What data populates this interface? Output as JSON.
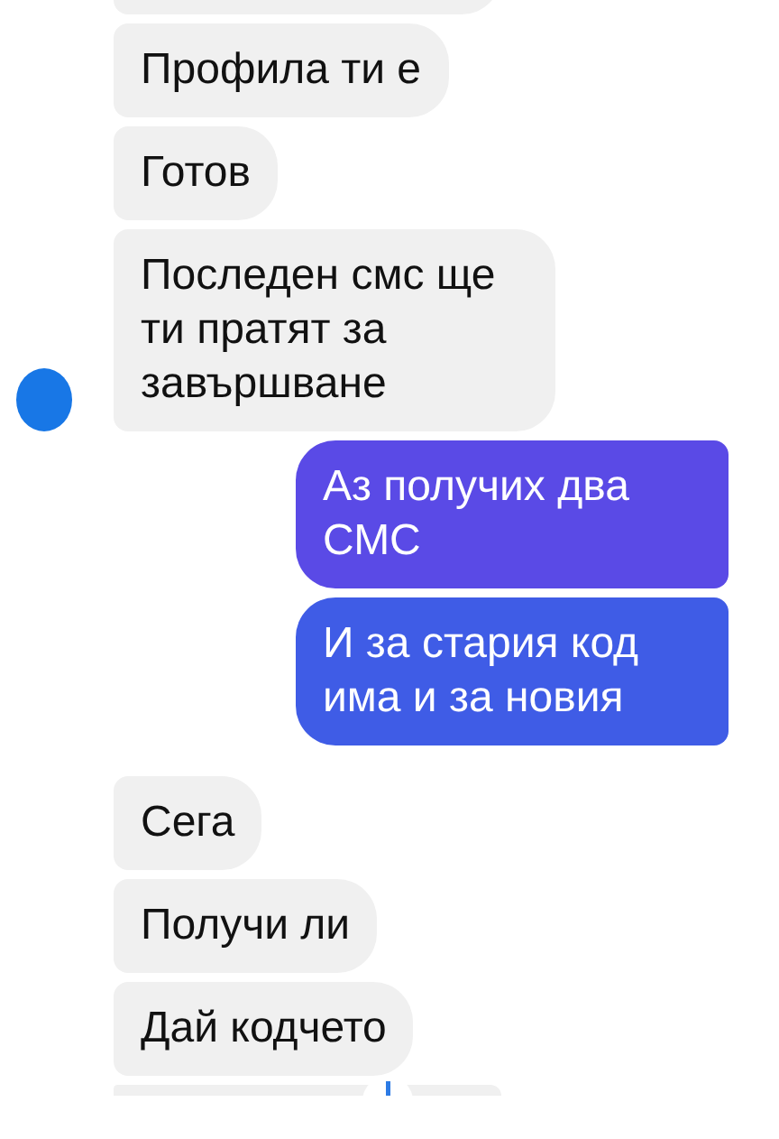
{
  "messages": [
    {
      "kind": "received-cut-top"
    },
    {
      "kind": "received",
      "text": "Профила ти е"
    },
    {
      "kind": "received",
      "text": "Готов"
    },
    {
      "kind": "received",
      "text": "Последен смс ще ти пратят за завършване",
      "avatar": true
    },
    {
      "kind": "sent",
      "text": "Аз получих два СМС",
      "color": "#5a4ae6"
    },
    {
      "kind": "sent",
      "text": "И за стария код има и за новия",
      "color": "#3f5ce6"
    },
    {
      "kind": "received",
      "text": "Сега"
    },
    {
      "kind": "received",
      "text": "Получи ли"
    },
    {
      "kind": "received",
      "text": "Дай кодчето"
    },
    {
      "kind": "received-cut-bottom"
    }
  ]
}
